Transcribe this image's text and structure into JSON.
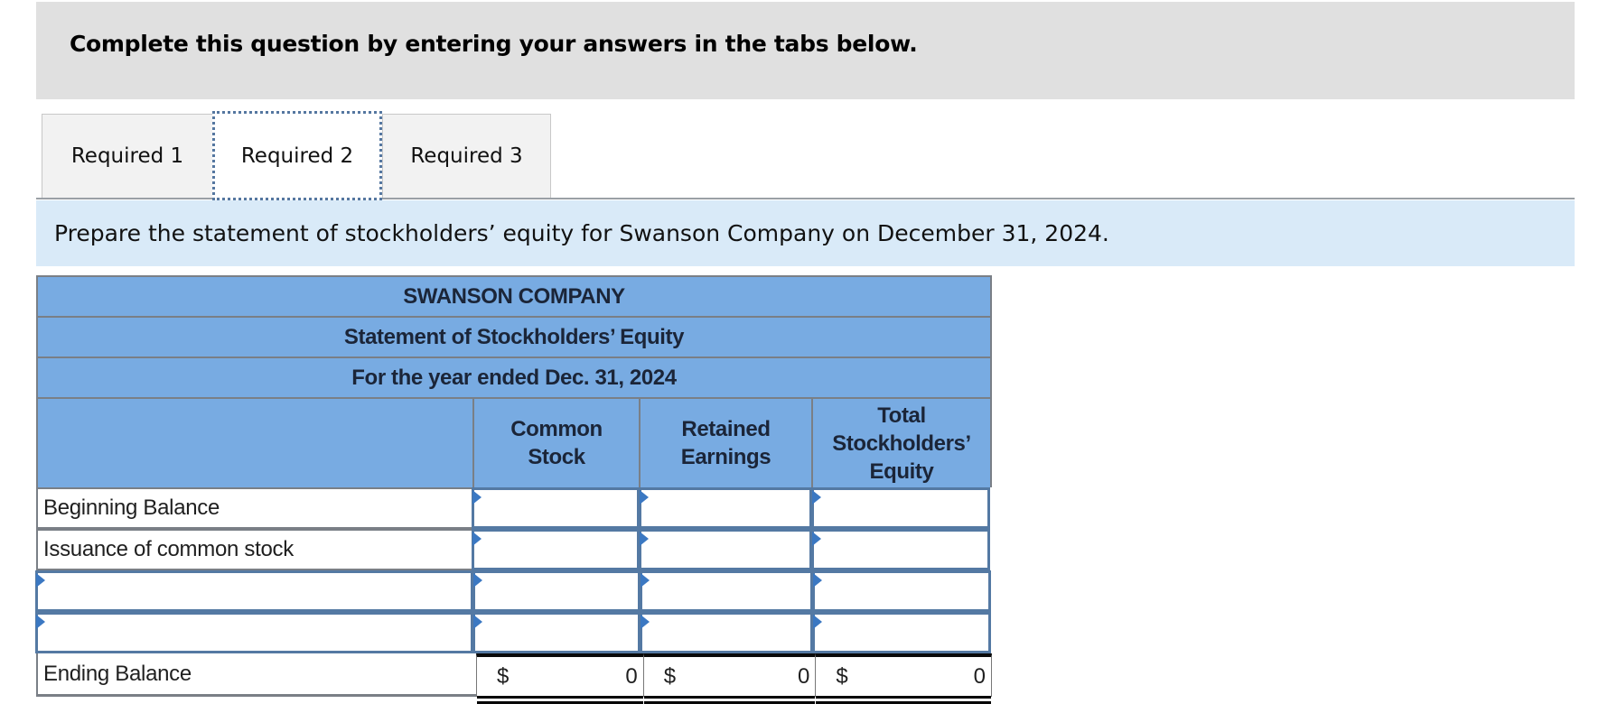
{
  "banner": {
    "text": "Complete this question by entering your answers in the tabs below."
  },
  "tabs": [
    {
      "label": "Required 1",
      "active": false
    },
    {
      "label": "Required 2",
      "active": true
    },
    {
      "label": "Required 3",
      "active": false
    }
  ],
  "instruction": "Prepare the statement of stockholders’ equity for Swanson Company on December 31, 2024.",
  "statement": {
    "company": "SWANSON COMPANY",
    "title": "Statement of Stockholders’ Equity",
    "period": "For the year ended Dec. 31, 2024",
    "columns": [
      "Common Stock",
      "Retained Earnings",
      "Total Stockholders’ Equity"
    ],
    "column_lines": [
      [
        "Common",
        "Stock"
      ],
      [
        "Retained",
        "Earnings"
      ],
      [
        "Total",
        "Stockholders’",
        "Equity"
      ]
    ],
    "rows": [
      {
        "label": "Beginning Balance",
        "label_editable": false,
        "values": [
          "",
          "",
          ""
        ]
      },
      {
        "label": "Issuance of common stock",
        "label_editable": false,
        "values": [
          "",
          "",
          ""
        ]
      },
      {
        "label": "",
        "label_editable": true,
        "values": [
          "",
          "",
          ""
        ]
      },
      {
        "label": "",
        "label_editable": true,
        "values": [
          "",
          "",
          ""
        ]
      }
    ],
    "ending": {
      "label": "Ending Balance",
      "currency": "$",
      "values": [
        "0",
        "0",
        "0"
      ]
    }
  },
  "colors": {
    "banner_bg": "#e0e0e0",
    "instruction_bg": "#d9eaf8",
    "table_header_bg": "#78abe2",
    "input_border": "#5479a3",
    "input_flag": "#3b78c2"
  }
}
